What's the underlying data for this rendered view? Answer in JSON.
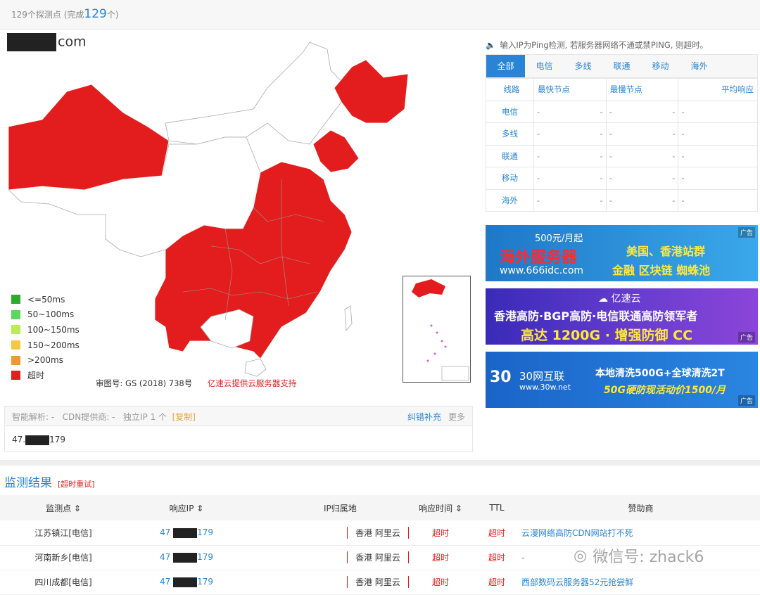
{
  "top": {
    "prefix": "129个探测点",
    "done_prefix": "(完成",
    "done_count": "129",
    "done_suffix": "个)"
  },
  "domain": {
    "suffix": "com"
  },
  "legend": [
    {
      "label": "<=50ms",
      "color": "#2eaa2e"
    },
    {
      "label": "50~100ms",
      "color": "#5cd65c"
    },
    {
      "label": "100~150ms",
      "color": "#b8ec5a"
    },
    {
      "label": "150~200ms",
      "color": "#f5c842"
    },
    {
      "label": ">200ms",
      "color": "#ee9933"
    },
    {
      "label": "超时",
      "color": "#e02020"
    }
  ],
  "map_footer": {
    "approval": "审图号: GS (2018) 738号",
    "sponsor": "亿速云提供云服务器支持"
  },
  "info": {
    "dns": "智能解析: -",
    "cdn": "CDN提供商: -",
    "ip_count": "独立IP 1 个",
    "copy": "[复制]",
    "fix": "纠错补充",
    "more": "更多",
    "ip_prefix": "47.",
    "ip_suffix": "179"
  },
  "notice": "输入IP为Ping检测, 若服务器网络不通或禁PING, 则超时。",
  "tabs": [
    "全部",
    "电信",
    "多线",
    "联通",
    "移动",
    "海外"
  ],
  "line_table": {
    "headers": [
      "线路",
      "最快节点",
      "最慢节点",
      "平均响应"
    ],
    "rows": [
      {
        "line": "电信",
        "fast": "-",
        "fast2": "-",
        "slow": "-",
        "slow2": "-",
        "avg": "-"
      },
      {
        "line": "多线",
        "fast": "-",
        "fast2": "-",
        "slow": "-",
        "slow2": "-",
        "avg": "-"
      },
      {
        "line": "联通",
        "fast": "-",
        "fast2": "-",
        "slow": "-",
        "slow2": "-",
        "avg": "-"
      },
      {
        "line": "移动",
        "fast": "-",
        "fast2": "-",
        "slow": "-",
        "slow2": "-",
        "avg": "-"
      },
      {
        "line": "海外",
        "fast": "-",
        "fast2": "-",
        "slow": "-",
        "slow2": "-",
        "avg": "-"
      }
    ]
  },
  "ads": [
    {
      "l1": "500元/月起",
      "l2": "海外服务器",
      "l3": "www.666idc.com",
      "r1": "美国、香港站群",
      "r2": "金融 区块链 蜘蛛池",
      "tag": "广告"
    },
    {
      "brand": "亿速云",
      "l1": "香港高防·BGP高防·电信联通高防领军者",
      "l2": "高达 1200G · 增强防御 CC",
      "tag": "广告"
    },
    {
      "brand": "30网互联",
      "url": "www.30w.net",
      "r1": "本地清洗500G+全球清洗2T",
      "r2": "50G硬防现活动价1500/月",
      "tag": "广告"
    }
  ],
  "results": {
    "title": "监测结果",
    "retry": "[超时重试]",
    "headers": [
      "监测点 ⇕",
      "响应IP ⇕",
      "IP归属地",
      "响应时间 ⇕",
      "TTL",
      "赞助商"
    ],
    "rows": [
      {
        "node": "江苏镇江[电信]",
        "ip_prefix": "47",
        "ip_suffix": "179",
        "location": "香港 阿里云",
        "time": "超时",
        "ttl": "超时",
        "sponsor": "云漫网络高防CDN网站打不死"
      },
      {
        "node": "河南新乡[电信]",
        "ip_prefix": "47",
        "ip_suffix": "179",
        "location": "香港 阿里云",
        "time": "超时",
        "ttl": "超时",
        "sponsor": "-"
      },
      {
        "node": "四川成都[电信]",
        "ip_prefix": "47",
        "ip_suffix": "179",
        "location": "香港 阿里云",
        "time": "超时",
        "ttl": "超时",
        "sponsor": "西部数码云服务器52元抢尝鲜"
      }
    ]
  },
  "watermark": "微信号: zhack6"
}
